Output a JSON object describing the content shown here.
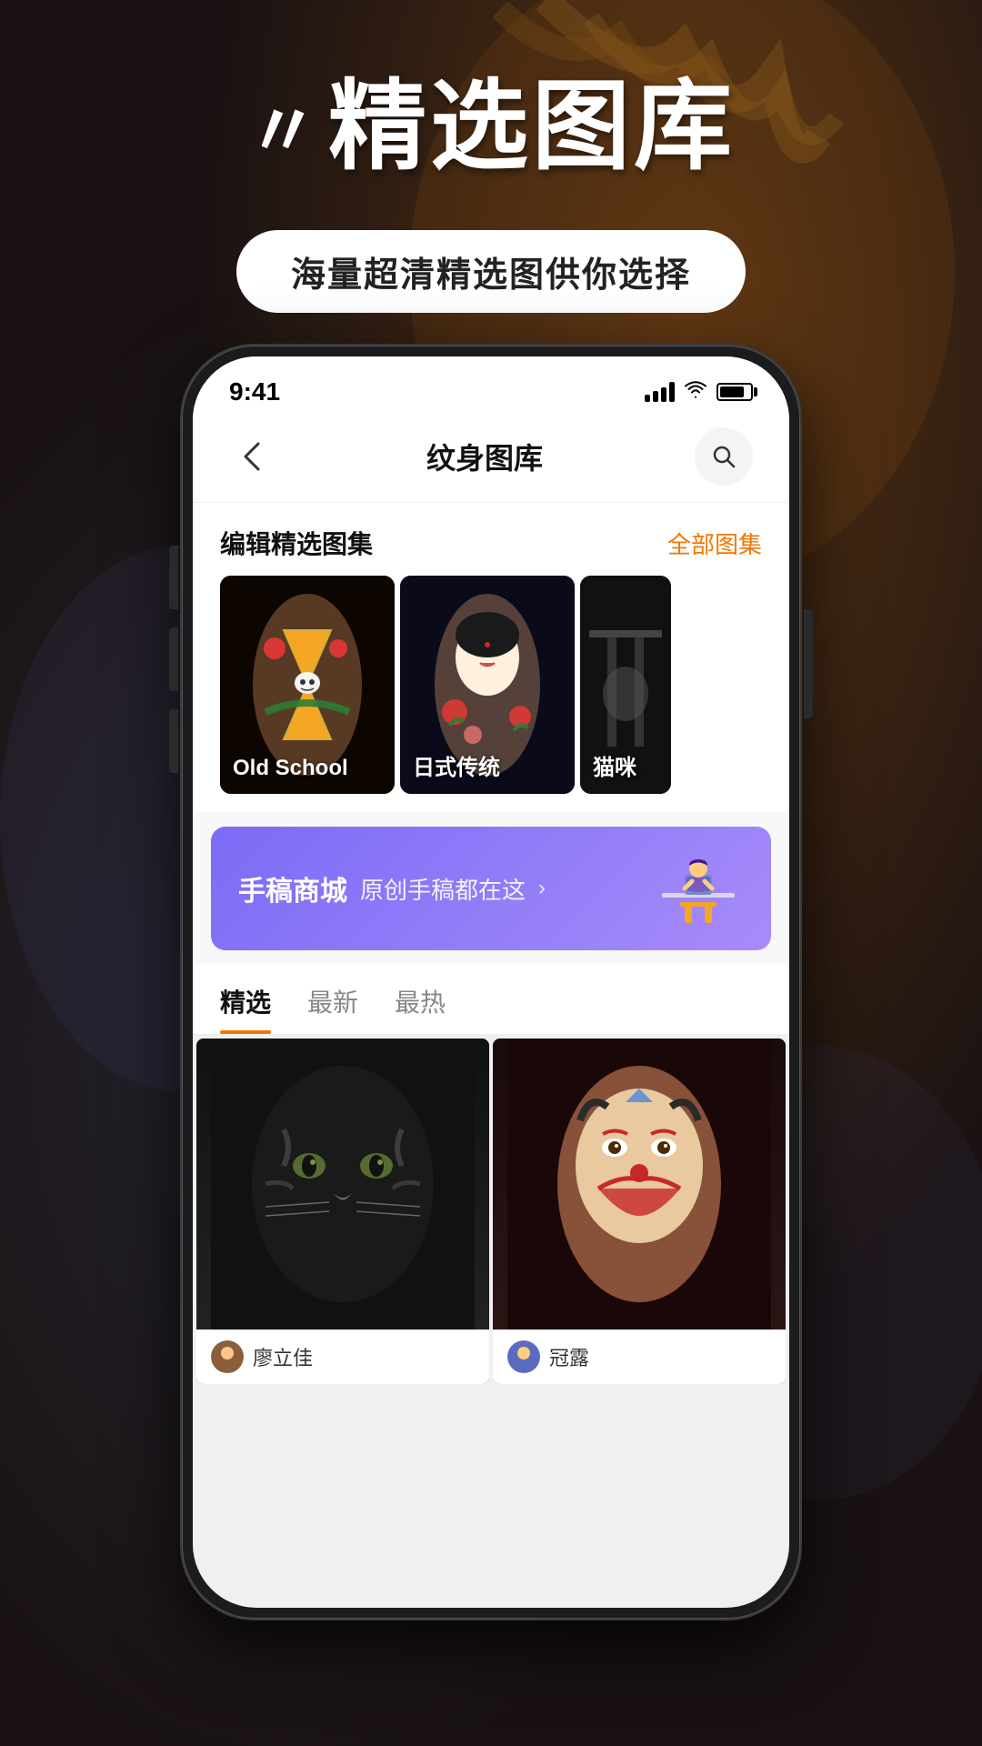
{
  "background": {
    "overlay": "dark tattoo art background"
  },
  "header": {
    "quote_marks": "〃",
    "title": "精选图库",
    "subtitle": "海量超清精选图供你选择"
  },
  "phone": {
    "status_bar": {
      "time": "9:41",
      "signal": "signal",
      "wifi": "wifi",
      "battery": "battery"
    },
    "nav": {
      "back_icon": "‹",
      "title": "纹身图库",
      "search_icon": "search"
    },
    "gallery_section": {
      "title": "编辑精选图集",
      "link": "全部图集",
      "items": [
        {
          "label": "Old School",
          "style": "tattoo-1"
        },
        {
          "label": "日式传统",
          "style": "tattoo-2"
        },
        {
          "label": "猫咪",
          "style": "tattoo-3"
        }
      ]
    },
    "banner": {
      "title": "手稿商城",
      "subtitle": "原创手稿都在这",
      "arrow": "›"
    },
    "tabs": [
      {
        "label": "精选",
        "active": true
      },
      {
        "label": "最新",
        "active": false
      },
      {
        "label": "最热",
        "active": false
      }
    ],
    "photos": [
      {
        "username": "廖立佳",
        "style": "tattoo-tiger"
      },
      {
        "username": "冠露",
        "style": "tattoo-joker"
      }
    ]
  }
}
